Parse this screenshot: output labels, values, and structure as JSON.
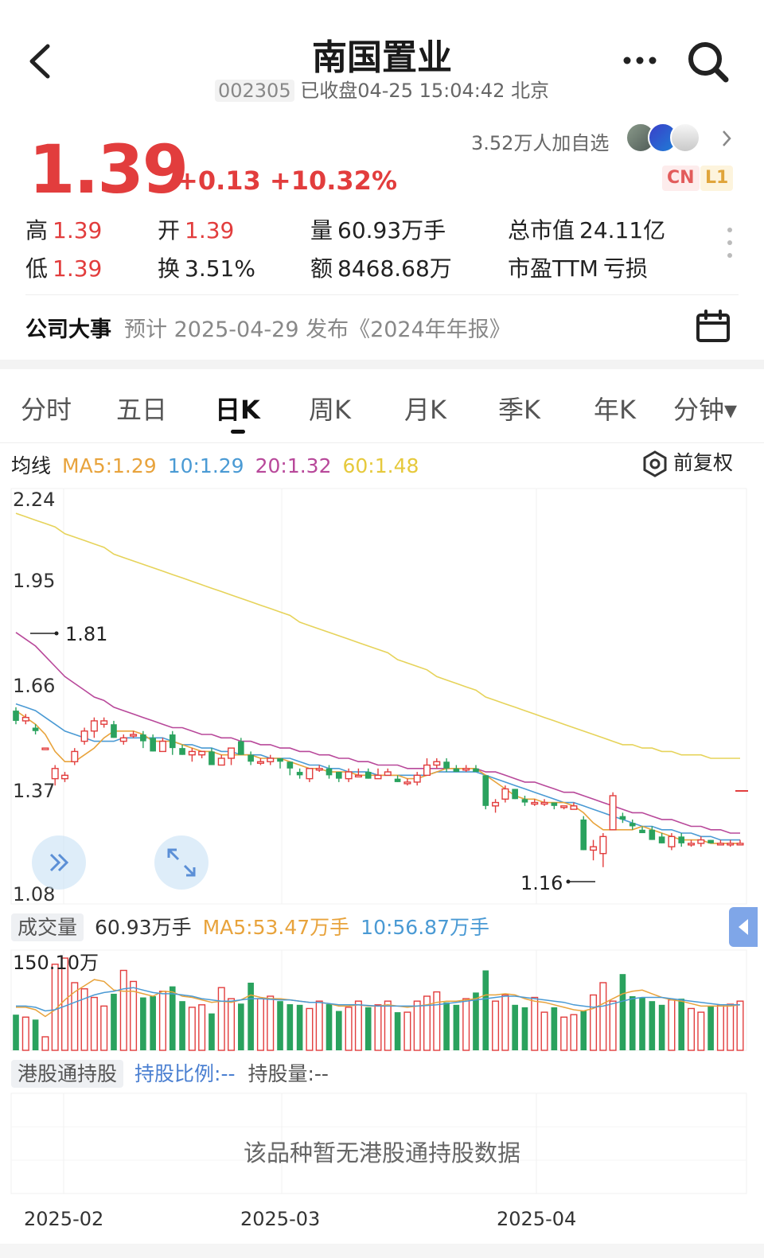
{
  "header": {
    "title": "南国置业",
    "code": "002305",
    "status": "已收盘04-25 15:04:42 北京"
  },
  "quote": {
    "price": "1.39",
    "change": "+0.13 +10.32%",
    "watchers": "3.52万人加自选",
    "tags": [
      "CN",
      "L1"
    ]
  },
  "stats": {
    "high_label": "高",
    "high": "1.39",
    "open_label": "开",
    "open": "1.39",
    "volume_label": "量",
    "volume": "60.93万手",
    "mcap_label": "总市值",
    "mcap": "24.11亿",
    "low_label": "低",
    "low": "1.39",
    "turnover_label": "换",
    "turnover": "3.51%",
    "amount_label": "额",
    "amount": "8468.68万",
    "pe_label": "市盈TTM",
    "pe": "亏损"
  },
  "event": {
    "label": "公司大事",
    "text": "预计 2025-04-29 发布《2024年年报》"
  },
  "tabs": [
    "分时",
    "五日",
    "日K",
    "周K",
    "月K",
    "季K",
    "年K",
    "分钟▾"
  ],
  "ma": {
    "label": "均线",
    "ma5": "MA5:1.29",
    "ma10": "10:1.29",
    "ma20": "20:1.32",
    "ma60": "60:1.48",
    "adjust": "前复权",
    "colors": {
      "ma5": "#e8a33c",
      "ma10": "#4a9ad4",
      "ma20": "#b8489a",
      "ma60": "#e6d35a",
      "up": "#e23d3d",
      "down": "#2aa25e"
    }
  },
  "price_axis": [
    "2.24",
    "1.95",
    "1.66",
    "1.37",
    "1.08"
  ],
  "annotations": {
    "max": "1.81",
    "min": "1.16"
  },
  "volume": {
    "label": "成交量",
    "current": "60.93万手",
    "ma5": "MA5:53.47万手",
    "ma10": "10:56.87万手",
    "axis_max": "150.10万"
  },
  "hk": {
    "label": "港股通持股",
    "ratio": "持股比例:--",
    "amount": "持股量:--",
    "empty": "该品种暂无港股通持股数据"
  },
  "dates": [
    "2025-02",
    "2025-03",
    "2025-04"
  ],
  "chart_data": {
    "type": "candlestick",
    "price_range": [
      1.08,
      2.24
    ],
    "candles": [
      [
        1.62,
        1.59,
        1.63,
        1.58
      ],
      [
        1.59,
        1.6,
        1.61,
        1.58
      ],
      [
        1.57,
        1.56,
        1.58,
        1.55
      ],
      [
        1.51,
        1.51,
        1.51,
        1.51
      ],
      [
        1.42,
        1.45,
        1.46,
        1.4
      ],
      [
        1.42,
        1.43,
        1.44,
        1.41
      ],
      [
        1.47,
        1.5,
        1.51,
        1.46
      ],
      [
        1.53,
        1.56,
        1.57,
        1.52
      ],
      [
        1.56,
        1.59,
        1.6,
        1.54
      ],
      [
        1.58,
        1.59,
        1.6,
        1.57
      ],
      [
        1.58,
        1.54,
        1.59,
        1.54
      ],
      [
        1.53,
        1.54,
        1.55,
        1.52
      ],
      [
        1.55,
        1.55,
        1.56,
        1.54
      ],
      [
        1.55,
        1.53,
        1.56,
        1.51
      ],
      [
        1.54,
        1.5,
        1.55,
        1.5
      ],
      [
        1.5,
        1.53,
        1.54,
        1.5
      ],
      [
        1.55,
        1.51,
        1.56,
        1.49
      ],
      [
        1.51,
        1.49,
        1.52,
        1.49
      ],
      [
        1.49,
        1.5,
        1.51,
        1.47
      ],
      [
        1.49,
        1.5,
        1.5,
        1.48
      ],
      [
        1.5,
        1.46,
        1.51,
        1.46
      ],
      [
        1.46,
        1.48,
        1.49,
        1.46
      ],
      [
        1.48,
        1.51,
        1.51,
        1.46
      ],
      [
        1.53,
        1.49,
        1.54,
        1.49
      ],
      [
        1.49,
        1.47,
        1.5,
        1.46
      ],
      [
        1.47,
        1.47,
        1.48,
        1.46
      ],
      [
        1.47,
        1.48,
        1.49,
        1.46
      ],
      [
        1.48,
        1.47,
        1.48,
        1.45
      ],
      [
        1.47,
        1.45,
        1.47,
        1.43
      ],
      [
        1.44,
        1.43,
        1.45,
        1.42
      ],
      [
        1.42,
        1.45,
        1.45,
        1.41
      ],
      [
        1.45,
        1.45,
        1.46,
        1.44
      ],
      [
        1.45,
        1.43,
        1.46,
        1.42
      ],
      [
        1.44,
        1.42,
        1.44,
        1.41
      ],
      [
        1.42,
        1.44,
        1.45,
        1.41
      ],
      [
        1.43,
        1.43,
        1.45,
        1.43
      ],
      [
        1.44,
        1.42,
        1.45,
        1.42
      ],
      [
        1.42,
        1.43,
        1.45,
        1.42
      ],
      [
        1.43,
        1.44,
        1.45,
        1.43
      ],
      [
        1.42,
        1.41,
        1.43,
        1.41
      ],
      [
        1.41,
        1.41,
        1.42,
        1.4
      ],
      [
        1.41,
        1.43,
        1.44,
        1.4
      ],
      [
        1.43,
        1.46,
        1.48,
        1.43
      ],
      [
        1.46,
        1.47,
        1.48,
        1.45
      ],
      [
        1.47,
        1.45,
        1.48,
        1.44
      ],
      [
        1.45,
        1.44,
        1.46,
        1.44
      ],
      [
        1.45,
        1.45,
        1.46,
        1.44
      ],
      [
        1.45,
        1.44,
        1.46,
        1.44
      ],
      [
        1.43,
        1.34,
        1.43,
        1.33
      ],
      [
        1.34,
        1.35,
        1.36,
        1.32
      ],
      [
        1.36,
        1.39,
        1.4,
        1.35
      ],
      [
        1.39,
        1.36,
        1.39,
        1.36
      ],
      [
        1.36,
        1.35,
        1.37,
        1.34
      ],
      [
        1.35,
        1.35,
        1.36,
        1.34
      ],
      [
        1.35,
        1.35,
        1.36,
        1.34
      ],
      [
        1.35,
        1.34,
        1.35,
        1.33
      ],
      [
        1.34,
        1.34,
        1.34,
        1.33
      ],
      [
        1.33,
        1.34,
        1.35,
        1.33
      ],
      [
        1.3,
        1.21,
        1.31,
        1.21
      ],
      [
        1.21,
        1.22,
        1.24,
        1.18
      ],
      [
        1.2,
        1.25,
        1.26,
        1.16
      ],
      [
        1.27,
        1.37,
        1.38,
        1.27
      ],
      [
        1.31,
        1.3,
        1.32,
        1.29
      ],
      [
        1.29,
        1.28,
        1.3,
        1.27
      ],
      [
        1.27,
        1.26,
        1.28,
        1.26
      ],
      [
        1.27,
        1.24,
        1.28,
        1.24
      ],
      [
        1.25,
        1.23,
        1.26,
        1.23
      ],
      [
        1.22,
        1.25,
        1.26,
        1.21
      ],
      [
        1.25,
        1.23,
        1.26,
        1.22
      ],
      [
        1.23,
        1.23,
        1.24,
        1.22
      ],
      [
        1.23,
        1.24,
        1.25,
        1.22
      ],
      [
        1.24,
        1.23,
        1.24,
        1.23
      ],
      [
        1.23,
        1.23,
        1.24,
        1.23
      ],
      [
        1.23,
        1.23,
        1.24,
        1.22
      ],
      [
        1.23,
        1.23,
        1.24,
        1.23
      ]
    ],
    "ma5": [
      1.62,
      1.6,
      1.58,
      1.55,
      1.5,
      1.47,
      1.47,
      1.49,
      1.51,
      1.54,
      1.56,
      1.56,
      1.56,
      1.55,
      1.53,
      1.53,
      1.53,
      1.52,
      1.51,
      1.5,
      1.5,
      1.49,
      1.49,
      1.49,
      1.49,
      1.48,
      1.48,
      1.48,
      1.47,
      1.46,
      1.45,
      1.45,
      1.44,
      1.44,
      1.44,
      1.43,
      1.43,
      1.43,
      1.43,
      1.43,
      1.42,
      1.42,
      1.43,
      1.44,
      1.45,
      1.45,
      1.45,
      1.45,
      1.43,
      1.41,
      1.39,
      1.37,
      1.36,
      1.36,
      1.35,
      1.35,
      1.35,
      1.34,
      1.32,
      1.29,
      1.27,
      1.27,
      1.27,
      1.27,
      1.28,
      1.27,
      1.26,
      1.25,
      1.24,
      1.24,
      1.24,
      1.23,
      1.23,
      1.23,
      1.23
    ],
    "ma10": [
      1.64,
      1.63,
      1.62,
      1.6,
      1.58,
      1.56,
      1.55,
      1.54,
      1.53,
      1.53,
      1.53,
      1.54,
      1.54,
      1.54,
      1.54,
      1.54,
      1.53,
      1.52,
      1.52,
      1.51,
      1.51,
      1.5,
      1.5,
      1.49,
      1.49,
      1.49,
      1.48,
      1.48,
      1.48,
      1.47,
      1.46,
      1.46,
      1.45,
      1.45,
      1.44,
      1.44,
      1.44,
      1.43,
      1.43,
      1.43,
      1.43,
      1.43,
      1.43,
      1.44,
      1.44,
      1.44,
      1.44,
      1.44,
      1.43,
      1.42,
      1.41,
      1.4,
      1.39,
      1.38,
      1.37,
      1.36,
      1.35,
      1.35,
      1.34,
      1.33,
      1.32,
      1.31,
      1.3,
      1.29,
      1.28,
      1.28,
      1.27,
      1.27,
      1.26,
      1.26,
      1.25,
      1.25,
      1.24,
      1.24,
      1.24
    ],
    "ma20": [
      1.85,
      1.83,
      1.81,
      1.78,
      1.75,
      1.72,
      1.7,
      1.68,
      1.66,
      1.65,
      1.63,
      1.62,
      1.61,
      1.6,
      1.59,
      1.58,
      1.57,
      1.57,
      1.56,
      1.55,
      1.55,
      1.54,
      1.54,
      1.53,
      1.53,
      1.52,
      1.52,
      1.51,
      1.51,
      1.5,
      1.5,
      1.49,
      1.49,
      1.48,
      1.48,
      1.47,
      1.47,
      1.46,
      1.46,
      1.46,
      1.45,
      1.45,
      1.45,
      1.45,
      1.45,
      1.45,
      1.45,
      1.45,
      1.44,
      1.44,
      1.43,
      1.42,
      1.41,
      1.41,
      1.4,
      1.39,
      1.38,
      1.38,
      1.37,
      1.36,
      1.35,
      1.34,
      1.33,
      1.32,
      1.32,
      1.31,
      1.3,
      1.3,
      1.29,
      1.28,
      1.28,
      1.27,
      1.27,
      1.26,
      1.26
    ],
    "ma60": [
      2.2,
      2.19,
      2.18,
      2.17,
      2.16,
      2.14,
      2.13,
      2.12,
      2.11,
      2.1,
      2.08,
      2.07,
      2.06,
      2.05,
      2.04,
      2.03,
      2.02,
      2.01,
      2.0,
      1.99,
      1.98,
      1.97,
      1.96,
      1.95,
      1.94,
      1.93,
      1.92,
      1.91,
      1.9,
      1.88,
      1.87,
      1.86,
      1.85,
      1.84,
      1.83,
      1.82,
      1.81,
      1.8,
      1.79,
      1.77,
      1.76,
      1.75,
      1.74,
      1.72,
      1.71,
      1.7,
      1.69,
      1.68,
      1.66,
      1.65,
      1.64,
      1.63,
      1.62,
      1.61,
      1.6,
      1.59,
      1.58,
      1.57,
      1.56,
      1.55,
      1.54,
      1.53,
      1.52,
      1.52,
      1.51,
      1.51,
      1.5,
      1.5,
      1.49,
      1.49,
      1.49,
      1.48,
      1.48,
      1.48,
      1.48
    ],
    "volume_range": [
      0,
      150.1
    ],
    "volumes": [
      58,
      54,
      50,
      22,
      140,
      150,
      110,
      100,
      86,
      72,
      92,
      130,
      112,
      86,
      88,
      96,
      104,
      80,
      70,
      74,
      60,
      102,
      84,
      76,
      110,
      84,
      88,
      80,
      75,
      74,
      68,
      80,
      75,
      64,
      70,
      80,
      70,
      74,
      80,
      62,
      62,
      80,
      88,
      95,
      78,
      74,
      84,
      94,
      130,
      80,
      90,
      74,
      70,
      86,
      62,
      70,
      54,
      58,
      64,
      90,
      110,
      80,
      124,
      88,
      86,
      80,
      74,
      82,
      84,
      68,
      62,
      72,
      74,
      75,
      80
    ],
    "vol_ma5": [
      70,
      70,
      66,
      55,
      66,
      82,
      95,
      105,
      115,
      112,
      98,
      96,
      96,
      92,
      88,
      96,
      95,
      88,
      86,
      82,
      78,
      80,
      78,
      82,
      90,
      86,
      84,
      84,
      82,
      80,
      78,
      78,
      76,
      72,
      72,
      74,
      72,
      72,
      74,
      72,
      70,
      72,
      74,
      78,
      80,
      80,
      82,
      84,
      90,
      90,
      92,
      90,
      84,
      80,
      78,
      74,
      70,
      66,
      64,
      68,
      76,
      84,
      92,
      96,
      98,
      92,
      86,
      82,
      80,
      76,
      72,
      72,
      72,
      72,
      74
    ],
    "vol_ma10": [
      72,
      72,
      70,
      64,
      66,
      72,
      78,
      84,
      90,
      94,
      96,
      100,
      102,
      98,
      94,
      92,
      92,
      90,
      88,
      84,
      82,
      80,
      80,
      82,
      84,
      84,
      83,
      82,
      82,
      80,
      78,
      78,
      76,
      74,
      74,
      74,
      73,
      72,
      72,
      72,
      72,
      72,
      73,
      74,
      76,
      78,
      80,
      82,
      84,
      86,
      88,
      88,
      86,
      84,
      82,
      80,
      78,
      74,
      72,
      70,
      72,
      76,
      80,
      84,
      86,
      86,
      86,
      84,
      82,
      80,
      78,
      76,
      74,
      74,
      74
    ]
  }
}
